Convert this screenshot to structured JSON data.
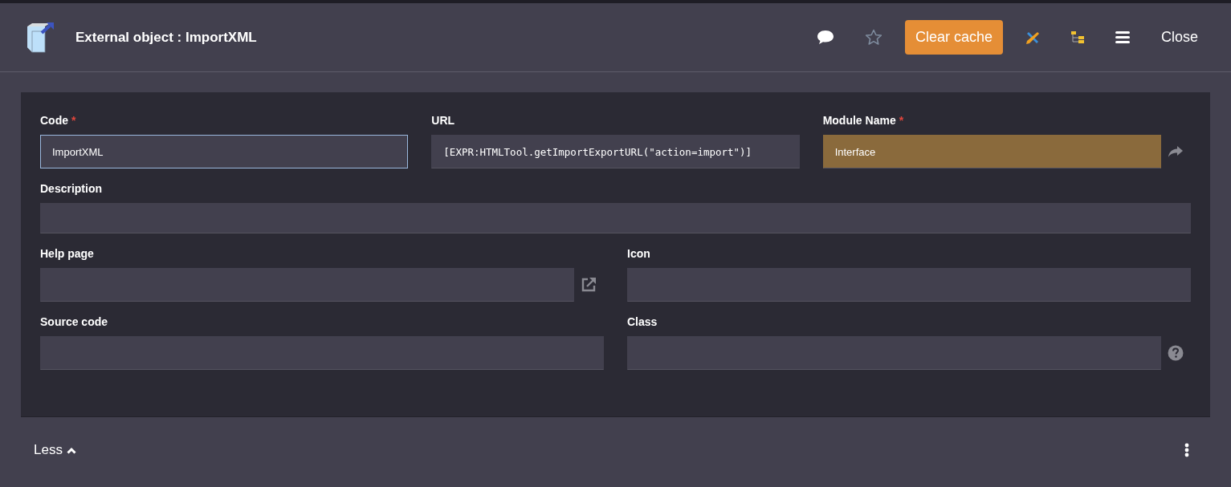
{
  "header": {
    "title": "External object : ImportXML",
    "clear_cache": "Clear cache",
    "close": "Close"
  },
  "rows": [
    [
      {
        "label": "Code",
        "required_mark": "*",
        "value": "ImportXML",
        "focused": true,
        "kind": "plain"
      },
      {
        "label": "URL",
        "value": "[EXPR:HTMLTool.getImportExportURL(\"action=import\")]",
        "focused": false,
        "kind": "code"
      },
      {
        "label": "Module Name",
        "required_mark": "*",
        "value": "Interface",
        "focused": false,
        "kind": "reference"
      }
    ],
    [
      {
        "label": "Description",
        "focused": false,
        "kind": "plain"
      }
    ],
    [
      {
        "label": "Help page",
        "focused": false,
        "kind": "url"
      },
      {
        "label": "Icon",
        "focused": false,
        "kind": "plain"
      }
    ],
    [
      {
        "label": "Source code",
        "focused": false,
        "kind": "plain"
      },
      {
        "label": "Class",
        "focused": false,
        "kind": "help"
      }
    ]
  ],
  "footer": {
    "toggle": "Less"
  }
}
